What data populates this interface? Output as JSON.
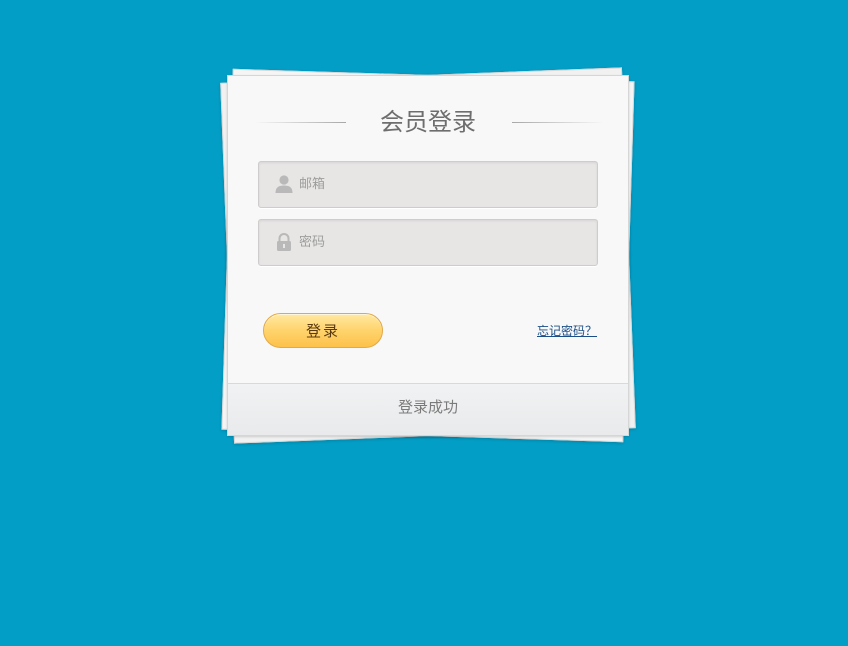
{
  "login_card": {
    "title": "会员登录",
    "email": {
      "placeholder": "邮箱",
      "value": "",
      "icon": "user-icon"
    },
    "password": {
      "placeholder": "密码",
      "value": "",
      "icon": "lock-icon"
    },
    "login_button_label": "登录",
    "forgot_link_label": "忘记密码？",
    "status_text": "登录成功"
  },
  "colors": {
    "background": "#039ec6",
    "card": "#f8f8f8",
    "button_top": "#ffe9a2",
    "button_bottom": "#fcc24a",
    "link": "#1b4e86"
  }
}
